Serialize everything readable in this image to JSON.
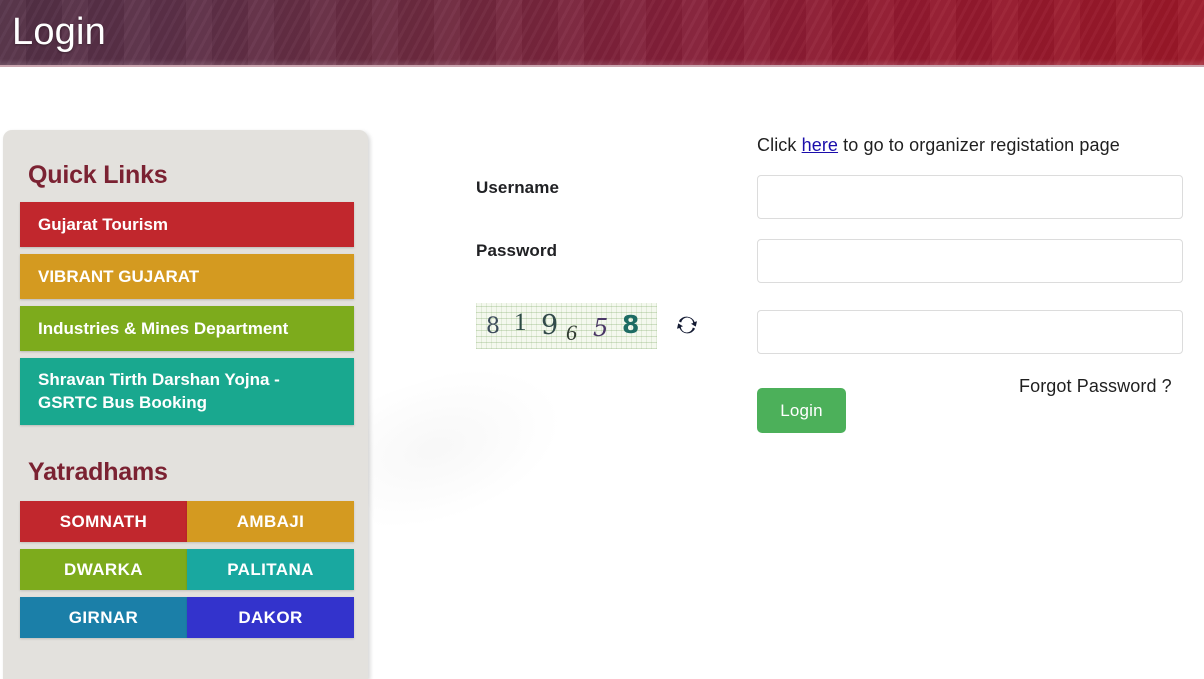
{
  "header": {
    "title": "Login",
    "gradient_start": "#533046",
    "gradient_end": "#9e1828"
  },
  "sidebar": {
    "quick_links_heading": "Quick Links",
    "quick_links": [
      {
        "label": "Gujarat Tourism",
        "color": "#c1272d"
      },
      {
        "label": "VIBRANT GUJARAT",
        "color": "#d49a20"
      },
      {
        "label": "Industries & Mines Department",
        "color": "#7dab1c"
      },
      {
        "label": "Shravan Tirth Darshan Yojna - GSRTC Bus Booking",
        "color": "#19a88f"
      }
    ],
    "yatradhams_heading": "Yatradhams",
    "yatradhams": [
      {
        "label": "SOMNATH",
        "color": "#c1272d"
      },
      {
        "label": "AMBAJI",
        "color": "#d49a20"
      },
      {
        "label": "DWARKA",
        "color": "#7dab1c"
      },
      {
        "label": "PALITANA",
        "color": "#19a8a0"
      },
      {
        "label": "GIRNAR",
        "color": "#1b7fa8"
      },
      {
        "label": "DAKOR",
        "color": "#3333cc"
      }
    ]
  },
  "login_form": {
    "register_prefix": "Click ",
    "register_link": "here",
    "register_suffix": " to go to organizer registation page",
    "username_label": "Username",
    "password_label": "Password",
    "username_value": "",
    "password_value": "",
    "captcha_value": "",
    "captcha_text": "819658",
    "captcha_chars": [
      "8",
      "1",
      "9",
      "6",
      "5",
      "8"
    ],
    "captcha_refresh_icon": "refresh-icon",
    "login_button_label": "Login",
    "forgot_password_label": "Forgot Password ?",
    "login_button_color": "#4cb05a",
    "link_color": "#1a0dab"
  }
}
